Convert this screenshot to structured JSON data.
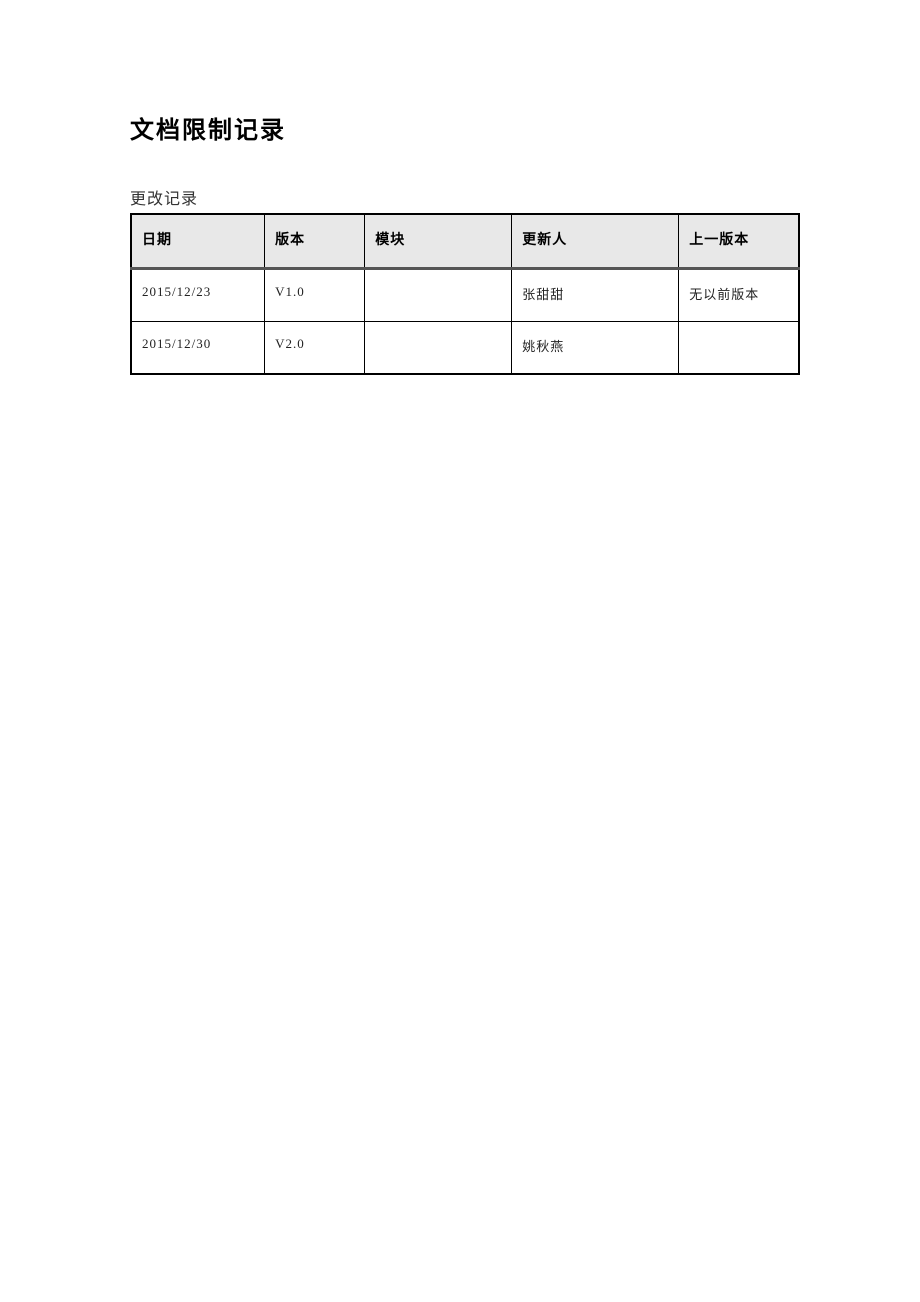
{
  "title": "文档限制记录",
  "subtitle": "更改记录",
  "headers": {
    "date": "日期",
    "version": "版本",
    "module": "模块",
    "updater": "更新人",
    "prev": "上一版本"
  },
  "rows": [
    {
      "date": "2015/12/23",
      "version": "V1.0",
      "module": "",
      "updater": "张甜甜",
      "prev": "无以前版本"
    },
    {
      "date": "2015/12/30",
      "version": "V2.0",
      "module": "",
      "updater": "姚秋燕",
      "prev": ""
    }
  ]
}
